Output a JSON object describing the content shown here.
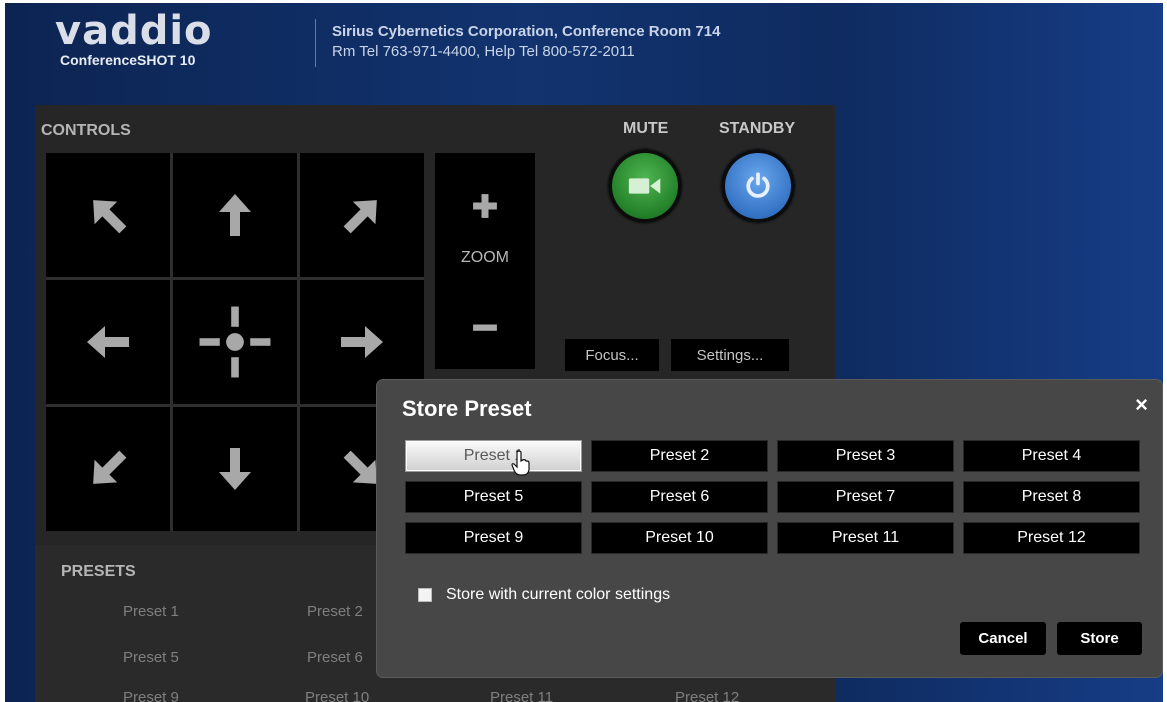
{
  "header": {
    "logo_text": "vaddio",
    "model": "ConferenceSHOT 10",
    "company_line": "Sirius Cybernetics Corporation, Conference Room 714",
    "contact_line": "Rm Tel 763-971-4400, Help Tel 800-572-2011"
  },
  "controls": {
    "section_label": "CONTROLS",
    "zoom_label": "ZOOM",
    "zoom_in_symbol": "+",
    "zoom_out_symbol": "−",
    "mute_label": "MUTE",
    "standby_label": "STANDBY",
    "focus_button": "Focus...",
    "settings_button": "Settings...",
    "ptz_icons": [
      "arrow-up-left-icon",
      "arrow-up-icon",
      "arrow-up-right-icon",
      "arrow-left-icon",
      "home-crosshair-icon",
      "arrow-right-icon",
      "arrow-down-left-icon",
      "arrow-down-icon",
      "arrow-down-right-icon"
    ]
  },
  "presets_section": {
    "label": "PRESETS",
    "items": [
      "Preset 1",
      "Preset 2",
      "Preset 5",
      "Preset 6",
      "Preset 9",
      "Preset 10",
      "Preset 11",
      "Preset 12"
    ]
  },
  "modal": {
    "title": "Store Preset",
    "close_symbol": "×",
    "presets": [
      "Preset 1",
      "Preset 2",
      "Preset 3",
      "Preset 4",
      "Preset 5",
      "Preset 6",
      "Preset 7",
      "Preset 8",
      "Preset 9",
      "Preset 10",
      "Preset 11",
      "Preset 12"
    ],
    "selected_index": 0,
    "checkbox_label": "Store with current color settings",
    "checkbox_checked": false,
    "cancel_label": "Cancel",
    "store_label": "Store"
  },
  "colors": {
    "mute_button": "#2e8f33",
    "standby_button": "#3b7fd4",
    "header_bg": "#12336f"
  }
}
